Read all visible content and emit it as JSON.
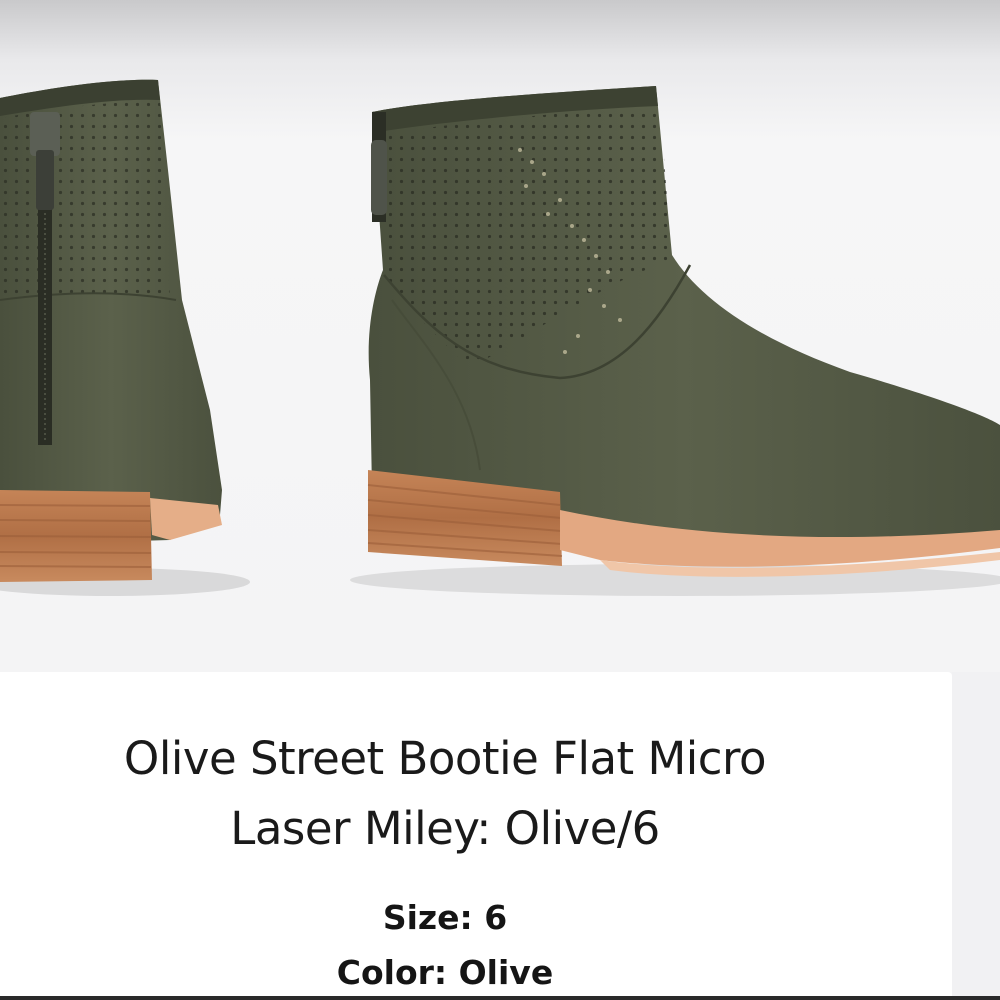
{
  "product": {
    "title": "Olive Street Bootie Flat Micro Laser Miley: Olive/6",
    "size_label": "Size:",
    "size_value": "6",
    "color_label": "Color:",
    "color_value": "Olive",
    "image_alt": "Olive suede ankle booties with perforated shaft and stacked wood heel"
  },
  "colors": {
    "suede": "#545a45",
    "suede_dark": "#3f4433",
    "heel": "#b9794f",
    "sole": "#e0a57e",
    "text": "#1a1a1a"
  }
}
